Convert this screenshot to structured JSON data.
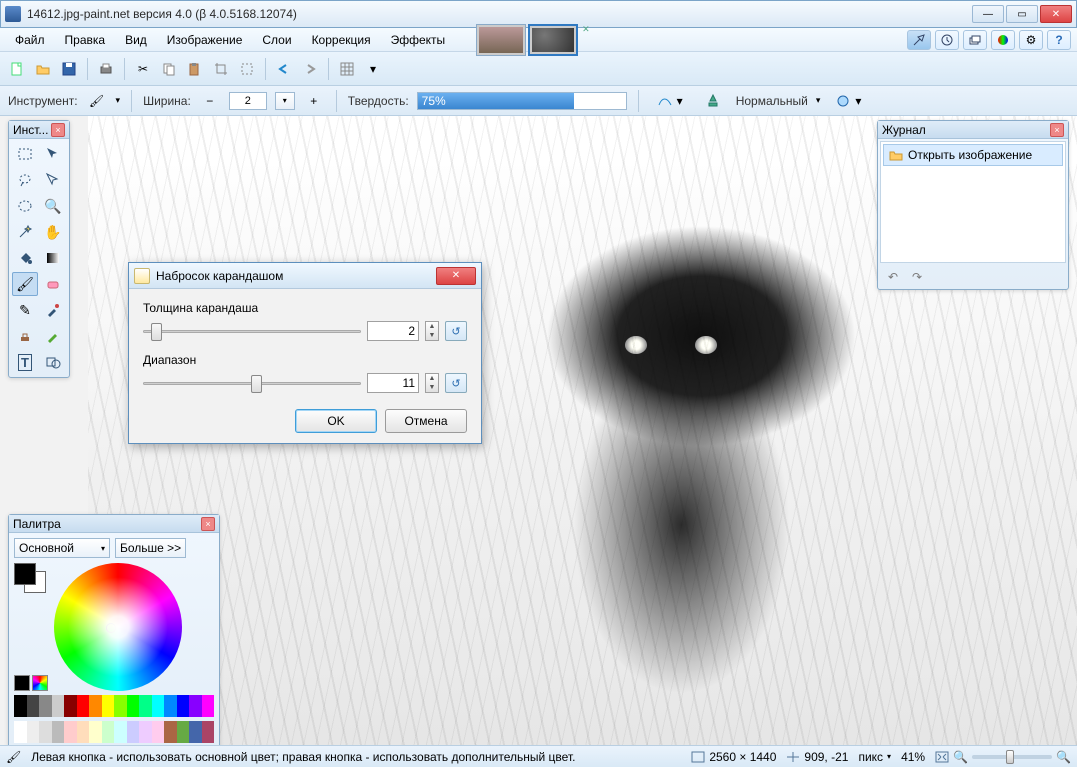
{
  "title": "14612.jpg-paint.net версия 4.0 (β 4.0.5168.12074)",
  "menu": [
    "Файл",
    "Правка",
    "Вид",
    "Изображение",
    "Слои",
    "Коррекция",
    "Эффекты"
  ],
  "opt": {
    "tool_label": "Инструмент:",
    "width_label": "Ширина:",
    "width_value": "2",
    "hardness_label": "Твердость:",
    "hardness_value": "75%",
    "blend_label": "Нормальный"
  },
  "tools_panel": {
    "title": "Инст..."
  },
  "history": {
    "title": "Журнал",
    "item": "Открыть изображение"
  },
  "dialog": {
    "title": "Набросок карандашом",
    "row1_label": "Толщина карандаша",
    "row1_value": "2",
    "row2_label": "Диапазон",
    "row2_value": "11",
    "ok": "OK",
    "cancel": "Отмена"
  },
  "palette": {
    "title": "Палитра",
    "mode": "Основной",
    "more": "Больше >>"
  },
  "status": {
    "hint": "Левая кнопка - использовать основной цвет; правая кнопка - использовать дополнительный цвет.",
    "dims": "2560 × 1440",
    "cursor": "909, -21",
    "unit": "пикс",
    "zoom": "41%"
  }
}
